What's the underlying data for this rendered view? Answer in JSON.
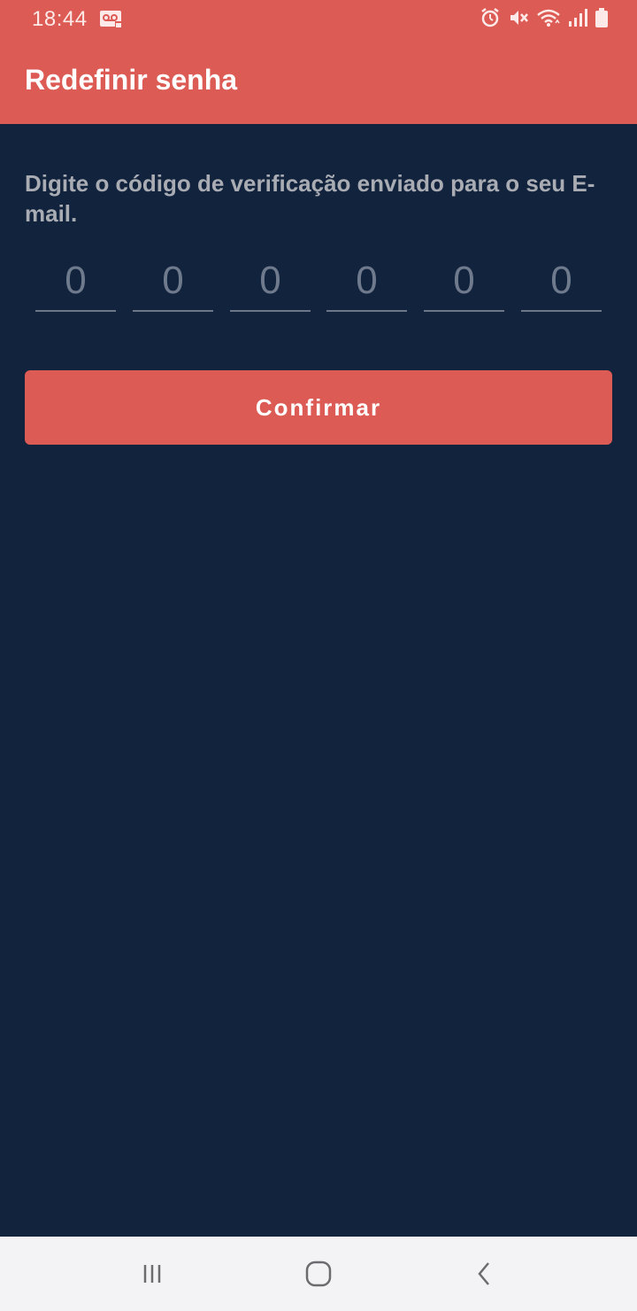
{
  "status_bar": {
    "time": "18:44",
    "icons": [
      "voicemail-icon",
      "alarm-icon",
      "vibrate-mute-icon",
      "wifi-icon",
      "signal-icon",
      "battery-icon"
    ]
  },
  "app_bar": {
    "title": "Redefinir senha"
  },
  "main": {
    "instruction": "Digite o código de verificação enviado para o seu E-mail.",
    "code_placeholders": [
      "0",
      "0",
      "0",
      "0",
      "0",
      "0"
    ],
    "confirm_label": "Confirmar"
  },
  "nav_bar": {
    "icons": [
      "recent-apps-icon",
      "home-icon",
      "back-icon"
    ]
  },
  "colors": {
    "accent": "#dc5b54",
    "background": "#12233e",
    "instruction_text": "#a9acb3",
    "placeholder_text": "#6f7b8d"
  }
}
